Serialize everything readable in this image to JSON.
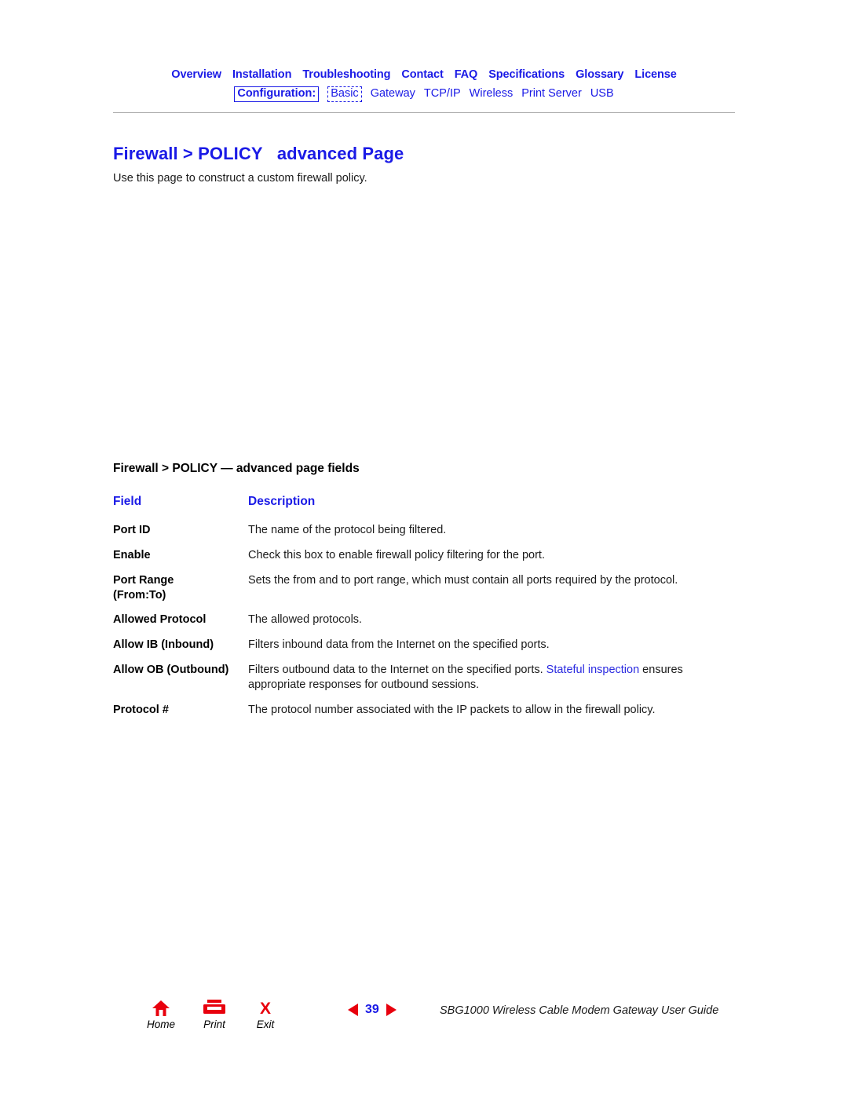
{
  "nav": {
    "primary": [
      {
        "label": "Overview",
        "icon": "nav-link"
      },
      {
        "label": "Installation",
        "icon": "nav-link"
      },
      {
        "label": "Troubleshooting",
        "icon": "nav-link"
      },
      {
        "label": "Contact",
        "icon": "nav-link"
      },
      {
        "label": "FAQ",
        "icon": "nav-link"
      },
      {
        "label": "Specifications",
        "icon": "nav-link"
      },
      {
        "label": "Glossary",
        "icon": "nav-link"
      },
      {
        "label": "License",
        "icon": "nav-link"
      }
    ],
    "secondary_label": "Configuration:",
    "secondary": [
      {
        "label": "Basic",
        "current": true
      },
      {
        "label": "Gateway",
        "current": false
      },
      {
        "label": "TCP/IP",
        "current": false
      },
      {
        "label": "Wireless",
        "current": false
      },
      {
        "label": "Print Server",
        "current": false
      },
      {
        "label": "USB",
        "current": false
      }
    ]
  },
  "page": {
    "title": "Firewall > POLICY   advanced Page",
    "intro": "Use this page to construct a custom firewall policy."
  },
  "table": {
    "caption": "Firewall > POLICY — advanced page fields",
    "headers": {
      "field": "Field",
      "description": "Description"
    },
    "rows": [
      {
        "field": "Port ID",
        "description": "The name of the protocol being filtered."
      },
      {
        "field": "Enable",
        "description": "Check this box to enable firewall policy filtering for the port."
      },
      {
        "field": "Port Range (From:To)",
        "field_line1": "Port Range",
        "field_line2": "(From:To)",
        "description": "Sets the from and to port range, which must contain all ports required by the protocol."
      },
      {
        "field": "Allowed Protocol",
        "description": "The allowed protocols."
      },
      {
        "field": "Allow IB (Inbound)",
        "description": "Filters inbound data from the Internet on the specified ports."
      },
      {
        "field": "Allow OB (Outbound)",
        "description": "Filters outbound data to the Internet on the specified ports. Stateful inspection ensures appropriate responses for outbound sessions.",
        "desc_part1": "Filters outbound data to the Internet on the specified ports. ",
        "desc_link": "Stateful inspection",
        "desc_part2": " ensures appropriate responses for outbound sessions."
      },
      {
        "field": "Protocol #",
        "description": "The protocol number associated with the IP packets to allow in the firewall policy."
      }
    ]
  },
  "footer": {
    "buttons": [
      {
        "label": "Home",
        "icon": "home-icon"
      },
      {
        "label": "Print",
        "icon": "printer-icon"
      },
      {
        "label": "Exit",
        "icon": "close-x-icon"
      }
    ],
    "prev_icon": "triangle-left-icon",
    "next_icon": "triangle-right-icon",
    "page_number": "39",
    "document_title": "SBG1000 Wireless Cable Modem Gateway User Guide"
  },
  "colors": {
    "link_blue": "#1A1AE6",
    "inline_link_blue": "#2A2AE0",
    "accent_red": "#E8000D",
    "rule_gray": "#a8a8a8"
  }
}
